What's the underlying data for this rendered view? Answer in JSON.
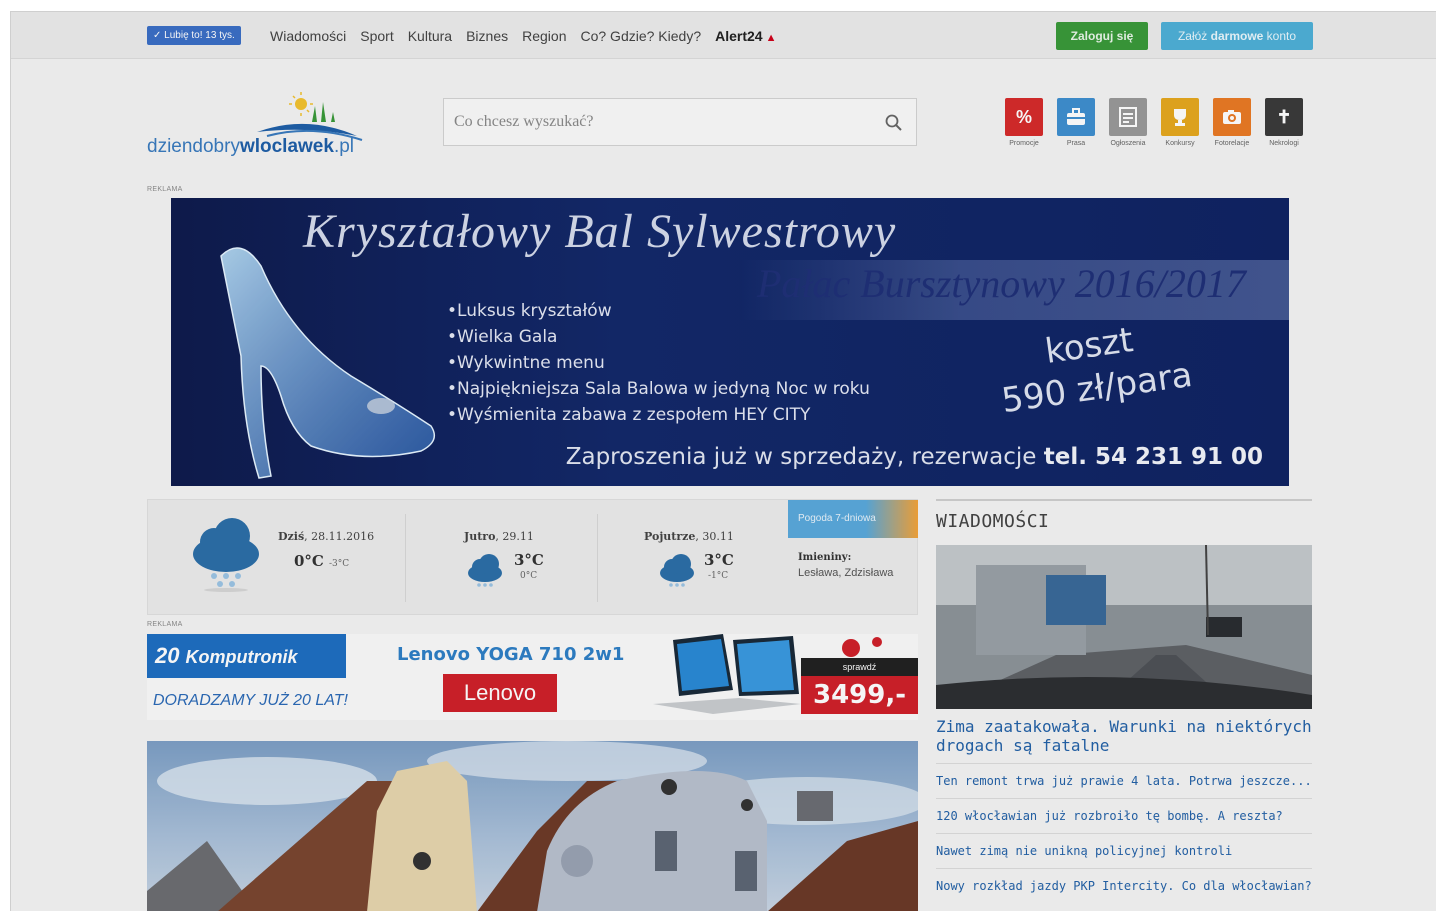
{
  "topbar": {
    "like_label": "✓ Lubię to! 13 tys.",
    "nav": [
      "Wiadomości",
      "Sport",
      "Kultura",
      "Biznes",
      "Region",
      "Co? Gdzie? Kiedy?"
    ],
    "alert_label": "Alert24",
    "login_label": "Zaloguj się",
    "register_prefix": "Załóż",
    "register_bold": "darmowe",
    "register_suffix": "konto"
  },
  "header": {
    "logo_regular": "dziendobry",
    "logo_bold": "wloclawek",
    "logo_suffix": ".pl",
    "search_placeholder": "Co chcesz wyszukać?"
  },
  "quick_links": [
    {
      "label": "Promocje",
      "glyph": "%",
      "color": "#d62b2b",
      "icon": "percent-icon"
    },
    {
      "label": "Prasa",
      "glyph": "💼",
      "color": "#3f8fd0",
      "icon": "briefcase-icon"
    },
    {
      "label": "Ogłoszenia",
      "glyph": "▤",
      "color": "#9a9a9a",
      "icon": "document-icon"
    },
    {
      "label": "Konkursy",
      "glyph": "🏆",
      "color": "#e5a81f",
      "icon": "trophy-icon"
    },
    {
      "label": "Fotorelacje",
      "glyph": "📷",
      "color": "#ea7a25",
      "icon": "camera-icon"
    },
    {
      "label": "Nekrologi",
      "glyph": "✝",
      "color": "#3b3b3b",
      "icon": "cross-icon"
    }
  ],
  "ads": {
    "label": "REKLAMA",
    "banner": {
      "title": "Kryształowy Bal Sylwestrowy",
      "subtitle": "Pałac Bursztynowy 2016/2017",
      "bullets": [
        "Luksus kryształów",
        "Wielka Gala",
        "Wykwintne menu",
        "Najpiękniejsza Sala Balowa w jedyną Noc w roku",
        "Wyśmienita zabawa z zespołem HEY CITY"
      ],
      "price_line1": "koszt",
      "price_line2": "590 zł/para",
      "footer_text": "Zaproszenia już w sprzedaży, rezerwacje",
      "footer_bold": "tel. 54 231 91 00"
    },
    "second": {
      "brand_number": "20",
      "brand": "Komputronik",
      "tagline": "DORADZAMY JUŻ 20 LAT!",
      "product": "Lenovo YOGA 710 2w1",
      "logo": "Lenovo",
      "cta": "sprawdź",
      "price": "3499,-"
    }
  },
  "weather": {
    "today_label": "Dziś",
    "today_date": "28.11.2016",
    "today_temp": "0°C",
    "today_min": "-3°C",
    "tomorrow_label": "Jutro",
    "tomorrow_date": "29.11",
    "tomorrow_temp": "3°C",
    "tomorrow_min": "0°C",
    "after_label": "Pojutrze",
    "after_date": "30.11",
    "after_temp": "3°C",
    "after_min": "-1°C",
    "forecast_link": "Pogoda 7-dniowa",
    "nameday_label": "Imieniny:",
    "nameday_names": "Lesława, Zdzisława"
  },
  "news": {
    "heading": "WIADOMOŚCI",
    "lead_title": "Zima zaatakowała. Warunki na niektórych drogach są fatalne",
    "items": [
      "Ten remont trwa już prawie 4 lata. Potrwa jeszcze...",
      "120 włocławian już rozbroiło tę bombę. A reszta?",
      "Nawet zimą nie unikną policyjnej kontroli",
      "Nowy rozkład jazdy PKP Intercity. Co dla włocławian?"
    ]
  }
}
